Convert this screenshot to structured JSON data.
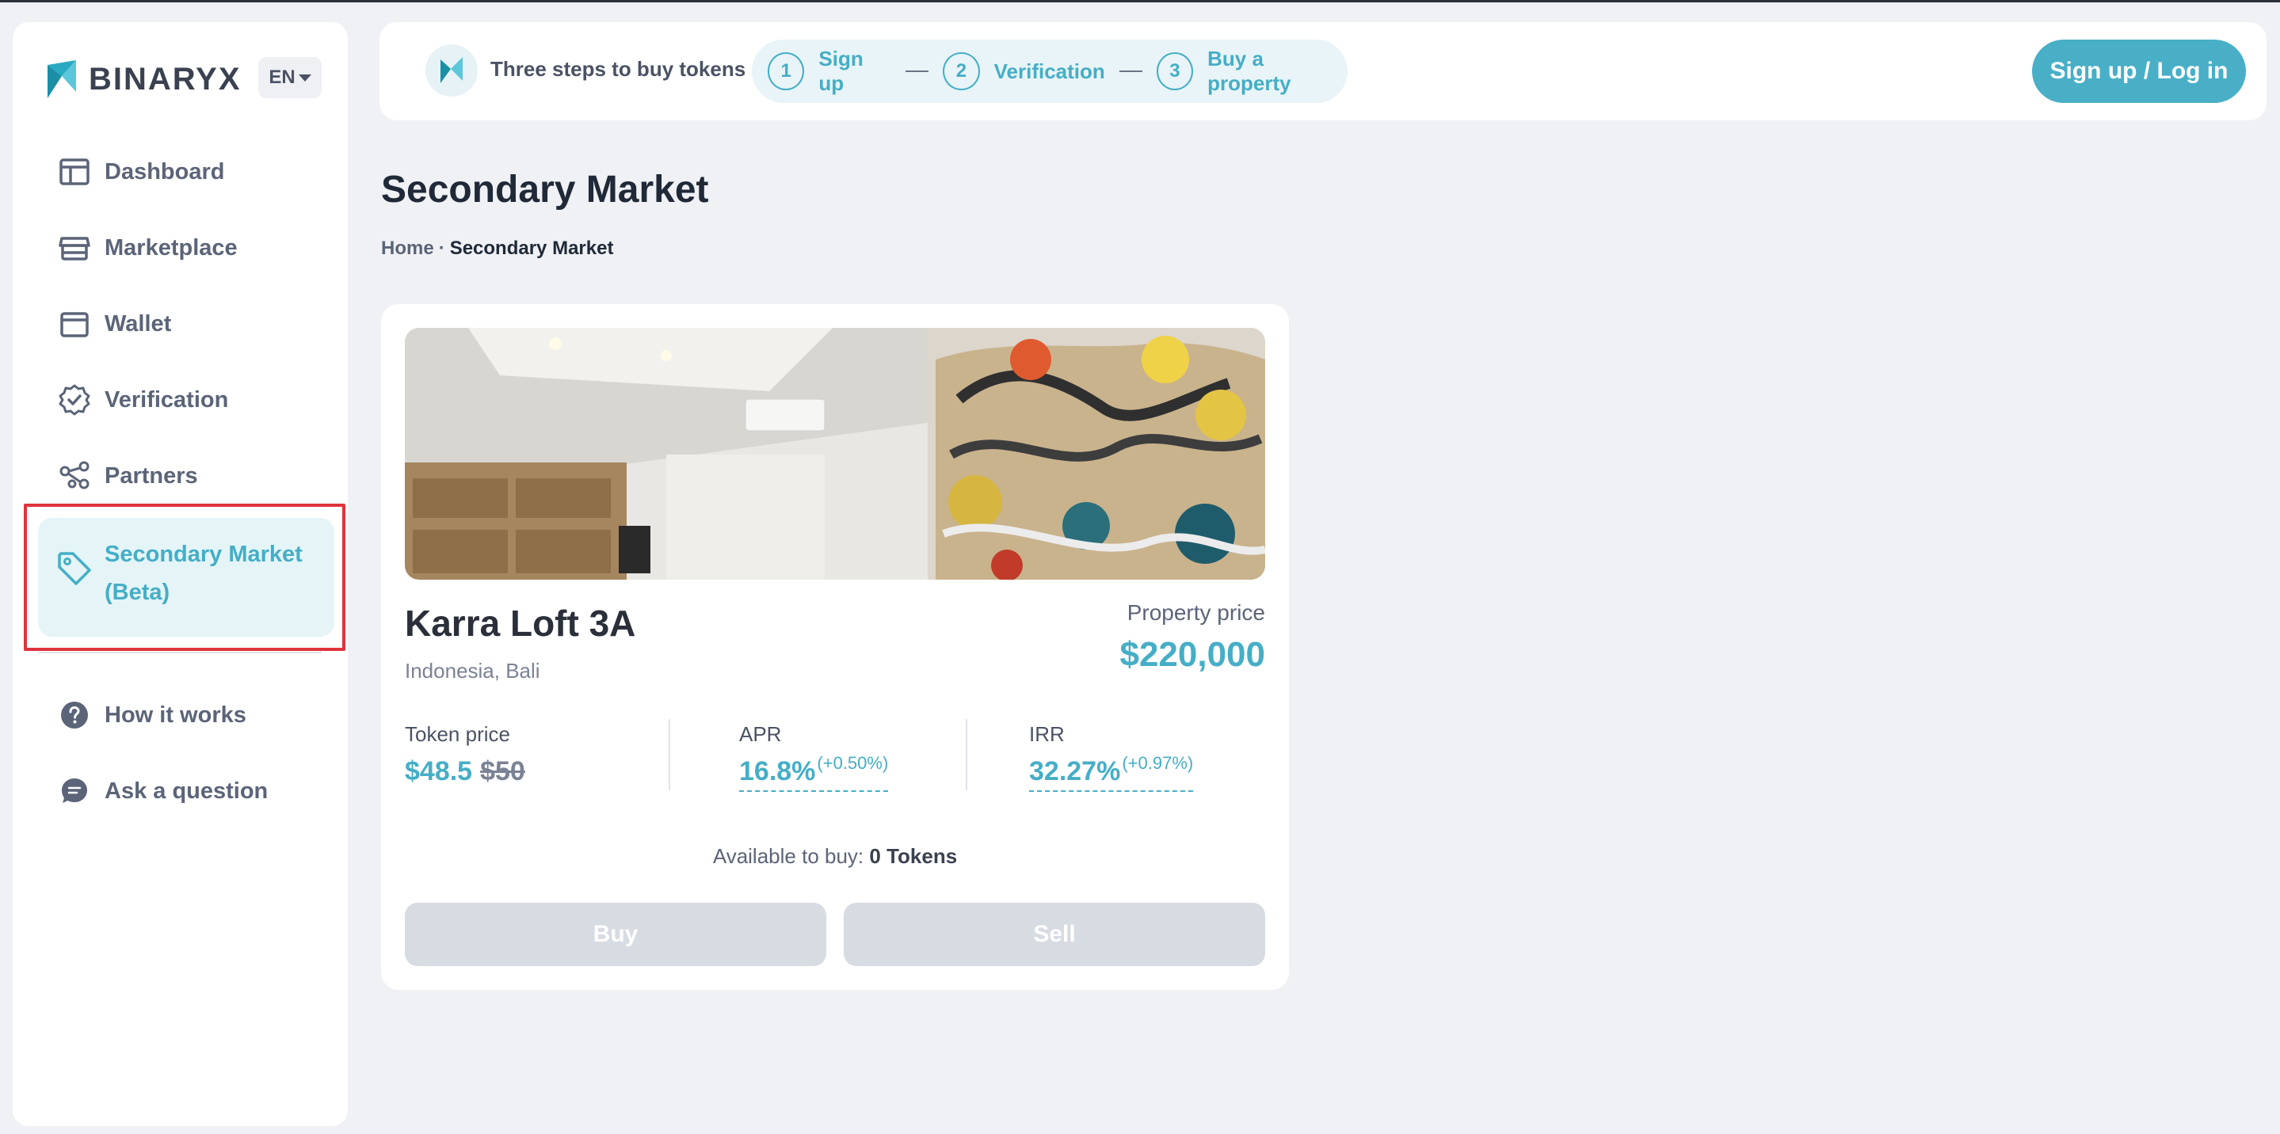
{
  "brand": {
    "name": "BINARYX",
    "language": "EN"
  },
  "sidebar": {
    "items": [
      {
        "label": "Dashboard",
        "icon": "dashboard-icon"
      },
      {
        "label": "Marketplace",
        "icon": "store-icon"
      },
      {
        "label": "Wallet",
        "icon": "wallet-icon"
      },
      {
        "label": "Verification",
        "icon": "verified-badge-icon"
      },
      {
        "label": "Partners",
        "icon": "share-network-icon"
      },
      {
        "label": "Secondary Market (Beta)",
        "icon": "tag-icon",
        "active": true
      }
    ],
    "secondary": [
      {
        "label": "How it works",
        "icon": "question-icon"
      },
      {
        "label": "Ask a question",
        "icon": "chat-bubble-icon"
      }
    ]
  },
  "topbar": {
    "steps_title": "Three steps to buy tokens",
    "steps": [
      {
        "num": "1",
        "label": "Sign up"
      },
      {
        "num": "2",
        "label": "Verification"
      },
      {
        "num": "3",
        "label": "Buy a property"
      }
    ],
    "login_label": "Sign up / Log in"
  },
  "page": {
    "title": "Secondary Market",
    "breadcrumb": {
      "home": "Home",
      "separator": "·",
      "current": "Secondary Market"
    }
  },
  "property": {
    "name": "Karra Loft 3A",
    "location": "Indonesia, Bali",
    "price_label": "Property price",
    "price": "$220,000",
    "token_price_label": "Token price",
    "token_price": "$48.5",
    "token_price_old": "$50",
    "apr_label": "APR",
    "apr": "16.8%",
    "apr_delta": "(+0.50%)",
    "irr_label": "IRR",
    "irr": "32.27%",
    "irr_delta": "(+0.97%)",
    "available_label": "Available to buy:",
    "available_value": "0 Tokens",
    "buy_label": "Buy",
    "sell_label": "Sell"
  },
  "colors": {
    "accent": "#45aec6",
    "background": "#eff1f5",
    "disabled": "#d7dbe2",
    "highlight": "#e0333c"
  }
}
